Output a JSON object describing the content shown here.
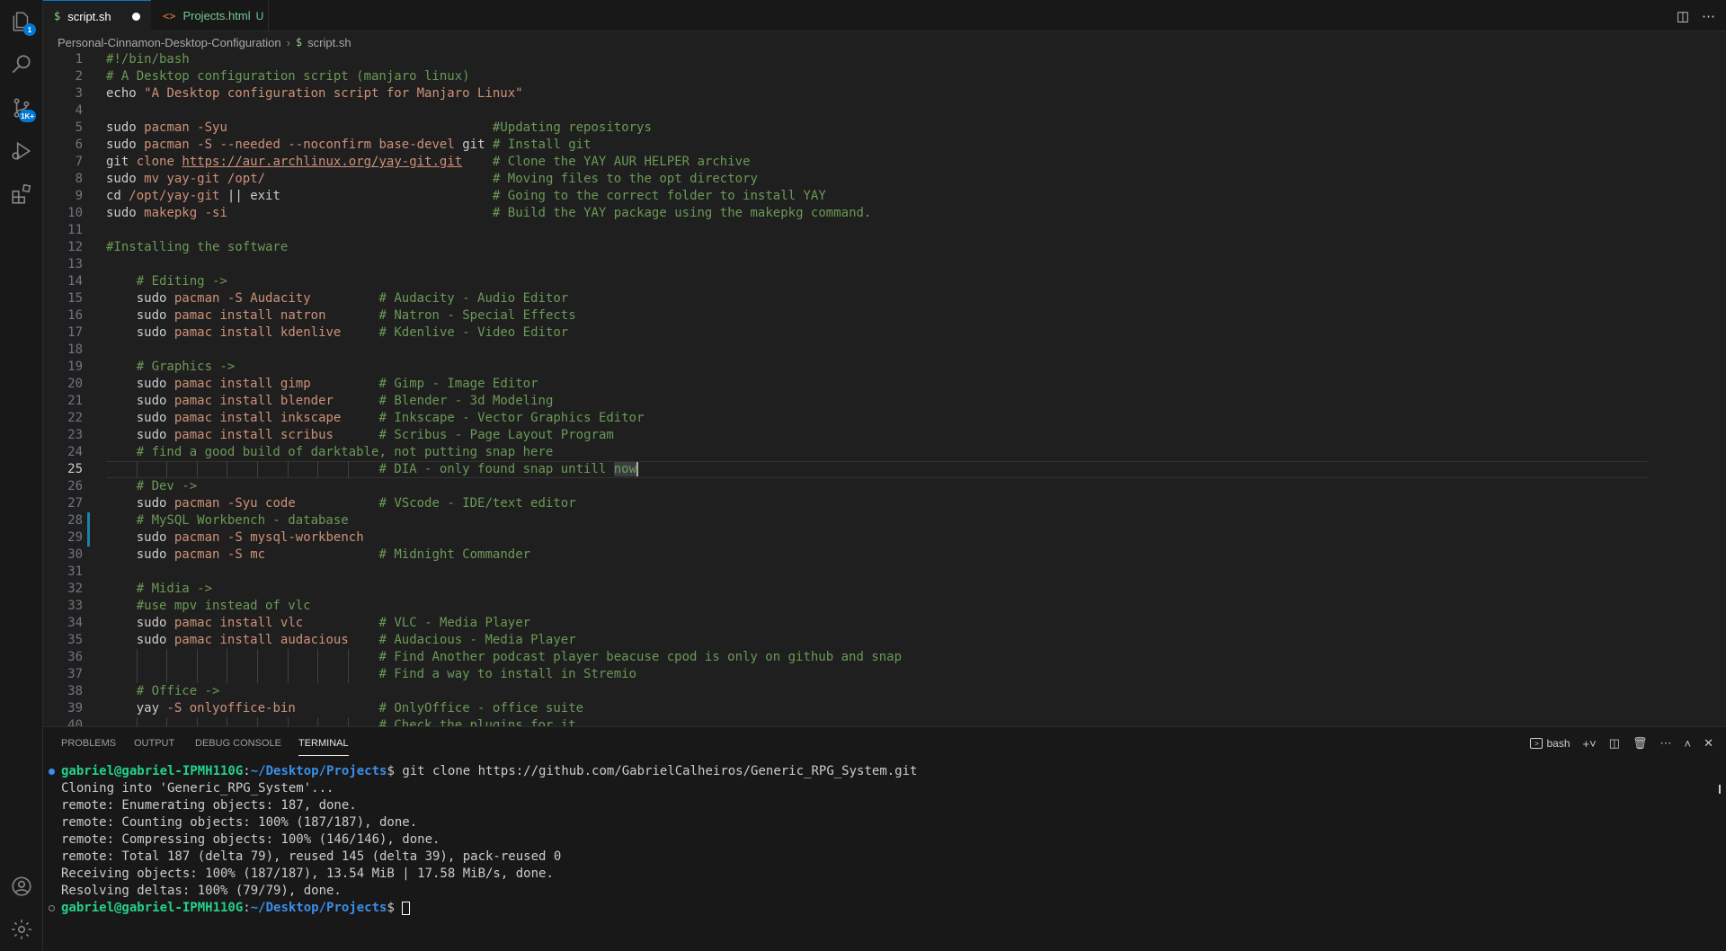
{
  "tabs": [
    {
      "icon": "$",
      "label": "script.sh",
      "dirty": true
    },
    {
      "icon": "<>",
      "label": "Projects.html",
      "status": "U"
    }
  ],
  "breadcrumb": {
    "folder": "Personal-Cinnamon-Desktop-Configuration",
    "file": "script.sh",
    "file_icon": "$"
  },
  "activity": {
    "explorer_badge": "1",
    "scm_badge": "1K+"
  },
  "editor": {
    "active_line": 25,
    "lines": [
      {
        "n": "1",
        "t": "#!/bin/bash"
      },
      {
        "n": "2",
        "t": "# A Desktop configuration script (manjaro linux)"
      },
      {
        "n": "3",
        "t": "echo \"A Desktop configuration script for Manjaro Linux\""
      },
      {
        "n": "4",
        "t": ""
      },
      {
        "n": "5",
        "t": "sudo pacman -Syu                                   #Updating repositorys"
      },
      {
        "n": "6",
        "t": "sudo pacman -S --needed --noconfirm base-devel git # Install git"
      },
      {
        "n": "7",
        "t": "git clone https://aur.archlinux.org/yay-git.git    # Clone the YAY AUR HELPER archive"
      },
      {
        "n": "8",
        "t": "sudo mv yay-git /opt/                              # Moving files to the opt directory"
      },
      {
        "n": "9",
        "t": "cd /opt/yay-git || exit                            # Going to the correct folder to install YAY"
      },
      {
        "n": "10",
        "t": "sudo makepkg -si                                   # Build the YAY package using the makepkg command."
      },
      {
        "n": "11",
        "t": ""
      },
      {
        "n": "12",
        "t": "#Installing the software"
      },
      {
        "n": "13",
        "t": ""
      },
      {
        "n": "14",
        "t": "    # Editing ->"
      },
      {
        "n": "15",
        "t": "    sudo pacman -S Audacity         # Audacity - Audio Editor"
      },
      {
        "n": "16",
        "t": "    sudo pamac install natron       # Natron - Special Effects"
      },
      {
        "n": "17",
        "t": "    sudo pamac install kdenlive     # Kdenlive - Video Editor"
      },
      {
        "n": "18",
        "t": ""
      },
      {
        "n": "19",
        "t": "    # Graphics ->"
      },
      {
        "n": "20",
        "t": "    sudo pamac install gimp         # Gimp - Image Editor"
      },
      {
        "n": "21",
        "t": "    sudo pamac install blender      # Blender - 3d Modeling"
      },
      {
        "n": "22",
        "t": "    sudo pamac install inkscape     # Inkscape - Vector Graphics Editor"
      },
      {
        "n": "23",
        "t": "    sudo pamac install scribus      # Scribus - Page Layout Program"
      },
      {
        "n": "24",
        "t": "    # find a good build of darktable, not putting snap here"
      },
      {
        "n": "25",
        "t": "                                    # DIA - only found snap untill now"
      },
      {
        "n": "26",
        "t": "    # Dev ->"
      },
      {
        "n": "27",
        "t": "    sudo pacman -Syu code           # VScode - IDE/text editor"
      },
      {
        "n": "28",
        "t": "    # MySQL Workbench - database"
      },
      {
        "n": "29",
        "t": "    sudo pacman -S mysql-workbench"
      },
      {
        "n": "30",
        "t": "    sudo pacman -S mc               # Midnight Commander"
      },
      {
        "n": "31",
        "t": ""
      },
      {
        "n": "32",
        "t": "    # Midia ->"
      },
      {
        "n": "33",
        "t": "    #use mpv instead of vlc"
      },
      {
        "n": "34",
        "t": "    sudo pamac install vlc          # VLC - Media Player"
      },
      {
        "n": "35",
        "t": "    sudo pamac install audacious    # Audacious - Media Player"
      },
      {
        "n": "36",
        "t": "                                    # Find Another podcast player beacuse cpod is only on github and snap"
      },
      {
        "n": "37",
        "t": "                                    # Find a way to install in Stremio"
      },
      {
        "n": "38",
        "t": "    # Office ->"
      },
      {
        "n": "39",
        "t": "    yay -S onlyoffice-bin           # OnlyOffice - office suite"
      },
      {
        "n": "40",
        "t": "                                    # Check the plugins for it"
      }
    ]
  },
  "panel": {
    "tabs": [
      "PROBLEMS",
      "OUTPUT",
      "DEBUG CONSOLE",
      "TERMINAL"
    ],
    "active_tab": "TERMINAL",
    "shell": "bash"
  },
  "terminal": {
    "prompt_user": "gabriel@gabriel-IPMH110G",
    "prompt_path": "~/Desktop/Projects",
    "command": "git clone https://github.com/GabrielCalheiros/Generic_RPG_System.git",
    "output": [
      "Cloning into 'Generic_RPG_System'...",
      "remote: Enumerating objects: 187, done.",
      "remote: Counting objects: 100% (187/187), done.",
      "remote: Compressing objects: 100% (146/146), done.",
      "remote: Total 187 (delta 79), reused 145 (delta 39), pack-reused 0",
      "Receiving objects: 100% (187/187), 13.54 MiB | 17.58 MiB/s, done.",
      "Resolving deltas: 100% (79/79), done."
    ]
  }
}
